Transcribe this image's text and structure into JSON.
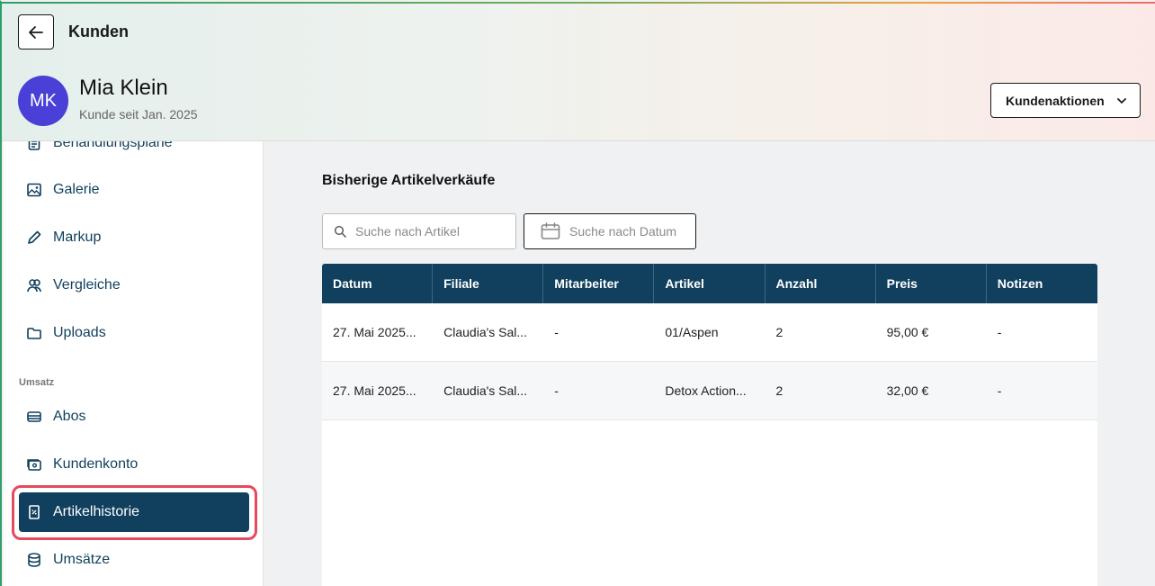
{
  "header": {
    "breadcrumb": "Kunden",
    "avatar_initials": "MK",
    "customer_name": "Mia Klein",
    "customer_since": "Kunde seit Jan. 2025",
    "actions_label": "Kundenaktionen"
  },
  "sidebar": {
    "items": [
      {
        "label": "Behandlungspläne",
        "icon": "document-icon"
      },
      {
        "label": "Galerie",
        "icon": "image-icon"
      },
      {
        "label": "Markup",
        "icon": "pencil-icon"
      },
      {
        "label": "Vergleiche",
        "icon": "users-icon"
      },
      {
        "label": "Uploads",
        "icon": "folder-icon"
      }
    ],
    "section_label": "Umsatz",
    "sales_items": [
      {
        "label": "Abos",
        "icon": "stack-icon"
      },
      {
        "label": "Kundenkonto",
        "icon": "wallet-icon"
      },
      {
        "label": "Artikelhistorie",
        "icon": "receipt-icon",
        "active": true
      },
      {
        "label": "Umsätze",
        "icon": "database-icon"
      }
    ]
  },
  "main": {
    "title": "Bisherige Artikelverkäufe",
    "search_placeholder": "Suche nach Artikel",
    "date_button": "Suche nach Datum",
    "table": {
      "columns": [
        "Datum",
        "Filiale",
        "Mitarbeiter",
        "Artikel",
        "Anzahl",
        "Preis",
        "Notizen"
      ],
      "rows": [
        [
          "27. Mai 2025...",
          "Claudia's Sal...",
          "-",
          "01/Aspen",
          "2",
          "95,00 €",
          "-"
        ],
        [
          "27. Mai 2025...",
          "Claudia's Sal...",
          "-",
          "Detox Action...",
          "2",
          "32,00 €",
          "-"
        ]
      ]
    }
  },
  "colors": {
    "primary": "#10405e",
    "avatar": "#4a3fd6",
    "highlight_ring": "#e54a5e"
  }
}
